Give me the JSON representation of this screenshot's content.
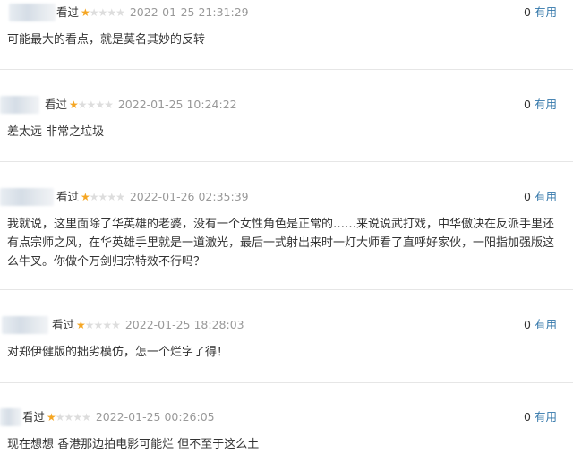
{
  "comments": [
    {
      "status": "看过",
      "rating": 1,
      "time": "2022-01-25 21:31:29",
      "votes": "0",
      "vote_label": "有用",
      "text": "可能最大的看点，就是莫名其妙的反转"
    },
    {
      "status": "看过",
      "rating": 1,
      "time": "2022-01-25 10:24:22",
      "votes": "0",
      "vote_label": "有用",
      "text": "差太远 非常之垃圾"
    },
    {
      "status": "看过",
      "rating": 1,
      "time": "2022-01-26 02:35:39",
      "votes": "0",
      "vote_label": "有用",
      "text": "我就说，这里面除了华英雄的老婆，没有一个女性角色是正常的……来说说武打戏，中华傲决在反派手里还有点宗师之风，在华英雄手里就是一道激光，最后一式射出来时一灯大师看了直呼好家伙，一阳指加强版这么牛叉。你做个万剑归宗特效不行吗？"
    },
    {
      "status": "看过",
      "rating": 1,
      "time": "2022-01-25 18:28:03",
      "votes": "0",
      "vote_label": "有用",
      "text": "对郑伊健版的拙劣模仿，怎一个烂字了得！"
    },
    {
      "status": "看过",
      "rating": 1,
      "time": "2022-01-25 00:26:05",
      "votes": "0",
      "vote_label": "有用",
      "text": "现在想想 香港那边拍电影可能烂 但不至于这么土"
    }
  ]
}
